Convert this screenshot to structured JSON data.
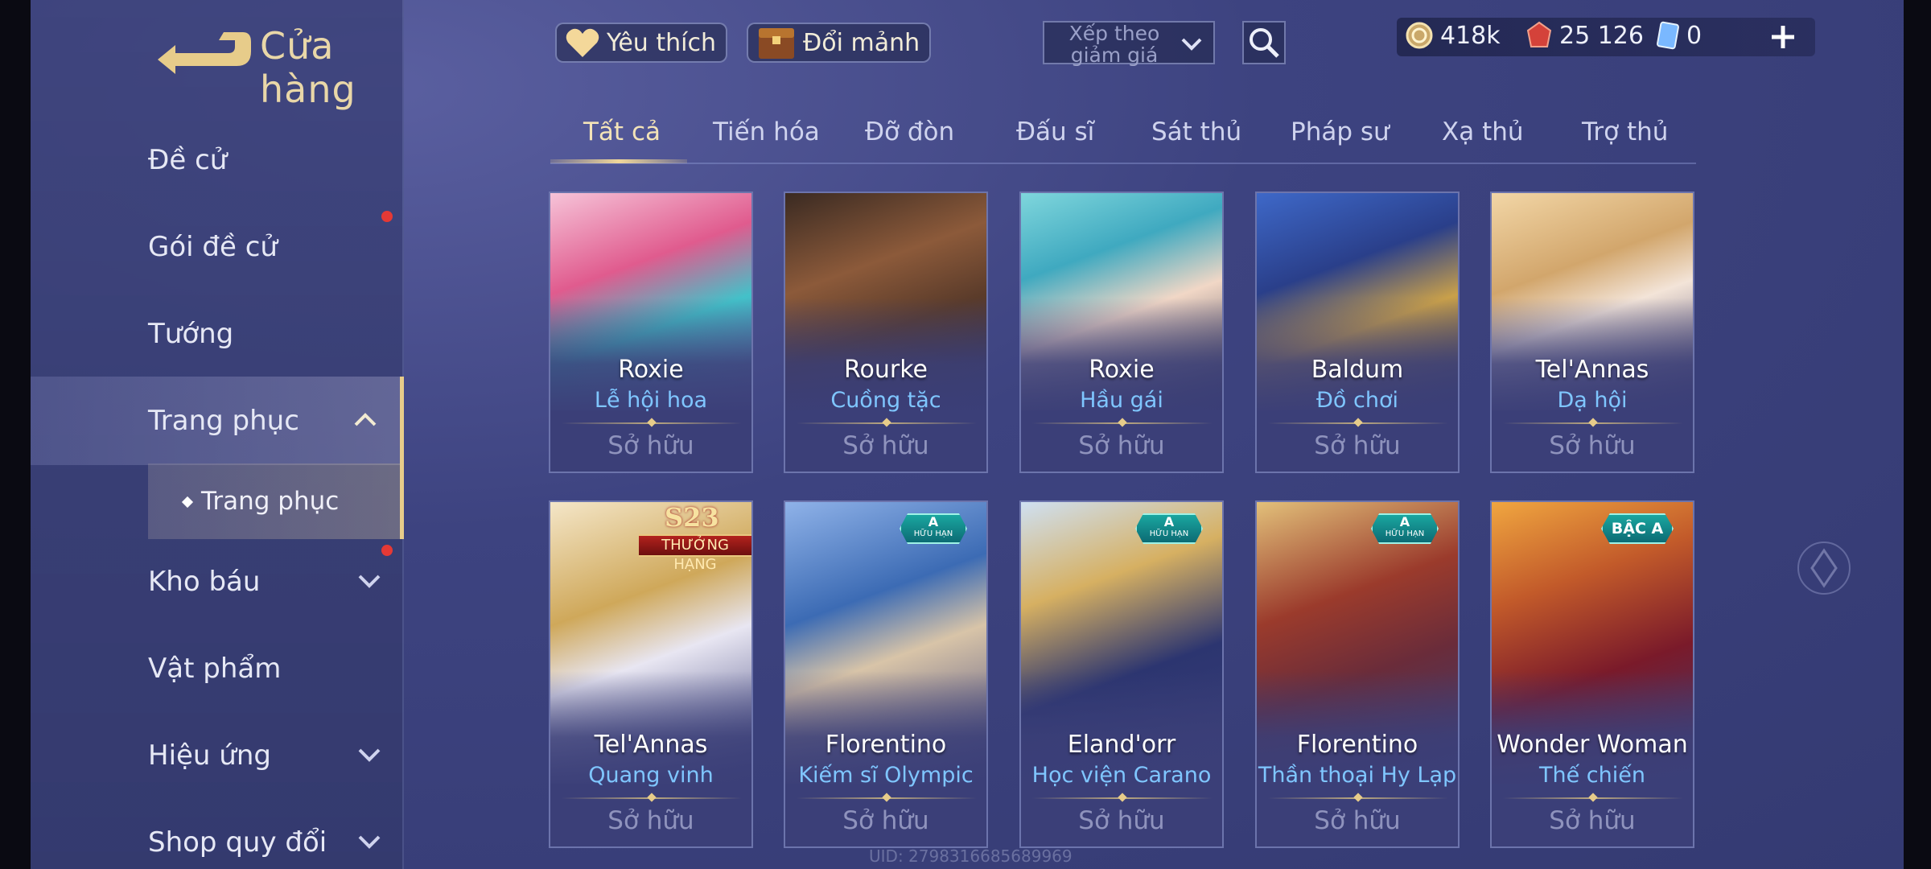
{
  "header": {
    "title": "Cửa hàng",
    "favorites_label": "Yêu thích",
    "exchange_label": "Đổi mảnh",
    "sort_label": "Xếp theo giảm giá"
  },
  "currency": {
    "gold": "418k",
    "vouchers": "25 126",
    "cards": "0"
  },
  "sidebar": {
    "items": [
      {
        "label": "Đề cử"
      },
      {
        "label": "Gói đề cử"
      },
      {
        "label": "Tướng"
      },
      {
        "label": "Trang phục"
      },
      {
        "label": "Kho báu"
      },
      {
        "label": "Vật phẩm"
      },
      {
        "label": "Hiệu ứng"
      },
      {
        "label": "Shop quy đổi"
      }
    ],
    "sub_item": "Trang phục"
  },
  "tabs": [
    "Tất cả",
    "Tiến hóa",
    "Đỡ đòn",
    "Đấu sĩ",
    "Sát thủ",
    "Pháp sư",
    "Xạ thủ",
    "Trợ thủ"
  ],
  "cards": [
    {
      "hero": "Roxie",
      "skin": "Lễ hội hoa",
      "status": "Sở hữu"
    },
    {
      "hero": "Rourke",
      "skin": "Cuồng tặc",
      "status": "Sở hữu"
    },
    {
      "hero": "Roxie",
      "skin": "Hầu gái",
      "status": "Sở hữu"
    },
    {
      "hero": "Baldum",
      "skin": "Đồ chơi",
      "status": "Sở hữu"
    },
    {
      "hero": "Tel'Annas",
      "skin": "Dạ hội",
      "status": "Sở hữu"
    },
    {
      "hero": "Tel'Annas",
      "skin": "Quang vinh",
      "status": "Sở hữu",
      "season_badge": "S23",
      "season_ribbon": "THƯỞNG HẠNG"
    },
    {
      "hero": "Florentino",
      "skin": "Kiếm sĩ Olympic",
      "status": "Sở hữu",
      "badge_a": "A",
      "badge_b": "HỮU HẠN"
    },
    {
      "hero": "Eland'orr",
      "skin": "Học viện Carano",
      "status": "Sở hữu",
      "badge_a": "A",
      "badge_b": "HỮU HẠN"
    },
    {
      "hero": "Florentino",
      "skin": "Thần thoại Hy Lạp",
      "status": "Sở hữu",
      "badge_a": "A",
      "badge_b": "HỮU HẠN"
    },
    {
      "hero": "Wonder Woman",
      "skin": "Thế chiến",
      "status": "Sở hữu",
      "badge_a": "BẬC A"
    }
  ],
  "uid": "UID: 2798316685689969",
  "colors": {
    "accent_gold": "#e7cc8a",
    "skin_name_blue": "#7fc6ff",
    "notification_red": "#e53935",
    "badge_teal": "#1aa7a0"
  },
  "icons": [
    "back-arrow-icon",
    "heart-icon",
    "chest-icon",
    "chevron-down-icon",
    "search-icon",
    "gold-coin-icon",
    "voucher-icon",
    "card-icon",
    "plus-icon",
    "chevron-up-icon",
    "diamond-bullet-icon"
  ]
}
